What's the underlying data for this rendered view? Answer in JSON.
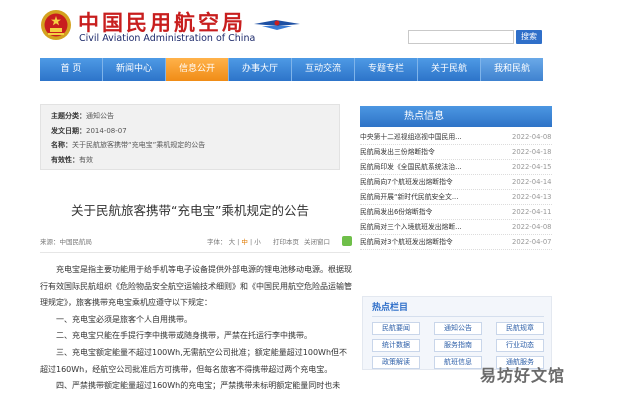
{
  "header": {
    "title_cn": "中国民用航空局",
    "title_en": "Civil Aviation Administration of China",
    "search_button": "搜索"
  },
  "nav": {
    "items": [
      "首 页",
      "新闻中心",
      "信息公开",
      "办事大厅",
      "互动交流",
      "专题专栏",
      "关于民航",
      "我和民航"
    ],
    "active_index": 2
  },
  "meta": {
    "rows": [
      {
        "label": "主题分类：",
        "value": "通知公告"
      },
      {
        "label": "发文日期：",
        "value": "2014-08-07"
      },
      {
        "label": "名称：",
        "value": "关于民航旅客携带“充电宝”乘机规定的公告"
      },
      {
        "label": "有效性：",
        "value": "有效"
      }
    ]
  },
  "article": {
    "title": "关于民航旅客携带“充电宝”乘机规定的公告",
    "source": "来源：中国民航局",
    "font_label": "字体：",
    "font_sizes": [
      "大",
      "中",
      "小"
    ],
    "font_selected": "中",
    "print": "打印本页",
    "close": "关闭窗口",
    "paragraphs": [
      "充电宝是指主要功能用于给手机等电子设备提供外部电源的锂电池移动电源。根据现行有效国际民航组织《危险物品安全航空运输技术细则》和《中国民用航空危险品运输管理规定》，旅客携带充电宝乘机应遵守以下规定：",
      "一、充电宝必须是旅客个人自用携带。",
      "二、充电宝只能在手提行李中携带或随身携带，严禁在托运行李中携带。",
      "三、充电宝额定能量不超过100Wh,无需航空公司批准；额定能量超过100Wh但不超过160Wh，经航空公司批准后方可携带，但每名旅客不得携带超过两个充电宝。",
      "四、严禁携带额定能量超过160Wh的充电宝；严禁携带未标明额定能量同时也未"
    ]
  },
  "hot": {
    "heading": "热点信息",
    "items": [
      {
        "title": "中央第十二巡视组巡视中国民用...",
        "date": "2022-04-08"
      },
      {
        "title": "民航局发出三份熔断指令",
        "date": "2022-04-18"
      },
      {
        "title": "民航局印发《全国民航系统法治...",
        "date": "2022-04-15"
      },
      {
        "title": "民航局向7个航班发出熔断指令",
        "date": "2022-04-14"
      },
      {
        "title": "民航局开展“新时代民航安全文...",
        "date": "2022-04-13"
      },
      {
        "title": "民航局发出6份熔断指令",
        "date": "2022-04-11"
      },
      {
        "title": "民航局对三个入境航班发出熔断...",
        "date": "2022-04-08"
      },
      {
        "title": "民航局对3个航班发出熔断指令",
        "date": "2022-04-07"
      }
    ]
  },
  "topics": {
    "heading": "热点栏目",
    "items": [
      "民航要闻",
      "通知公告",
      "民航规章",
      "统计数据",
      "服务指南",
      "行业动态",
      "政策解读",
      "航班信息",
      "通航服务"
    ]
  },
  "watermark": "易坊好文馆",
  "colors": {
    "nav_blue": "#3a86d6",
    "nav_active": "#f5a033",
    "title_red": "#c81e1e",
    "link_blue": "#2f6fc9"
  }
}
